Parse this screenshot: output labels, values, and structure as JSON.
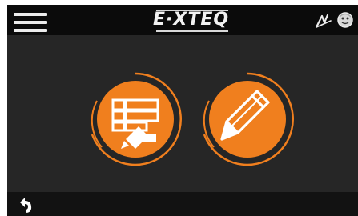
{
  "brand": {
    "logo_text": "E·XTEQ"
  },
  "header": {
    "menu_icon": "hamburger-menu-icon",
    "status_icons": [
      "signature-icon",
      "face-icon"
    ]
  },
  "main": {
    "tiles": [
      {
        "icon": "document-list-edit-icon"
      },
      {
        "icon": "pencil-icon"
      }
    ]
  },
  "footer": {
    "back_icon": "back-arrow-icon"
  },
  "colors": {
    "accent": "#f07f1e",
    "background": "#262626",
    "topbar": "#0b0b0b",
    "bottombar": "#121212",
    "icon_light": "#ececec"
  }
}
